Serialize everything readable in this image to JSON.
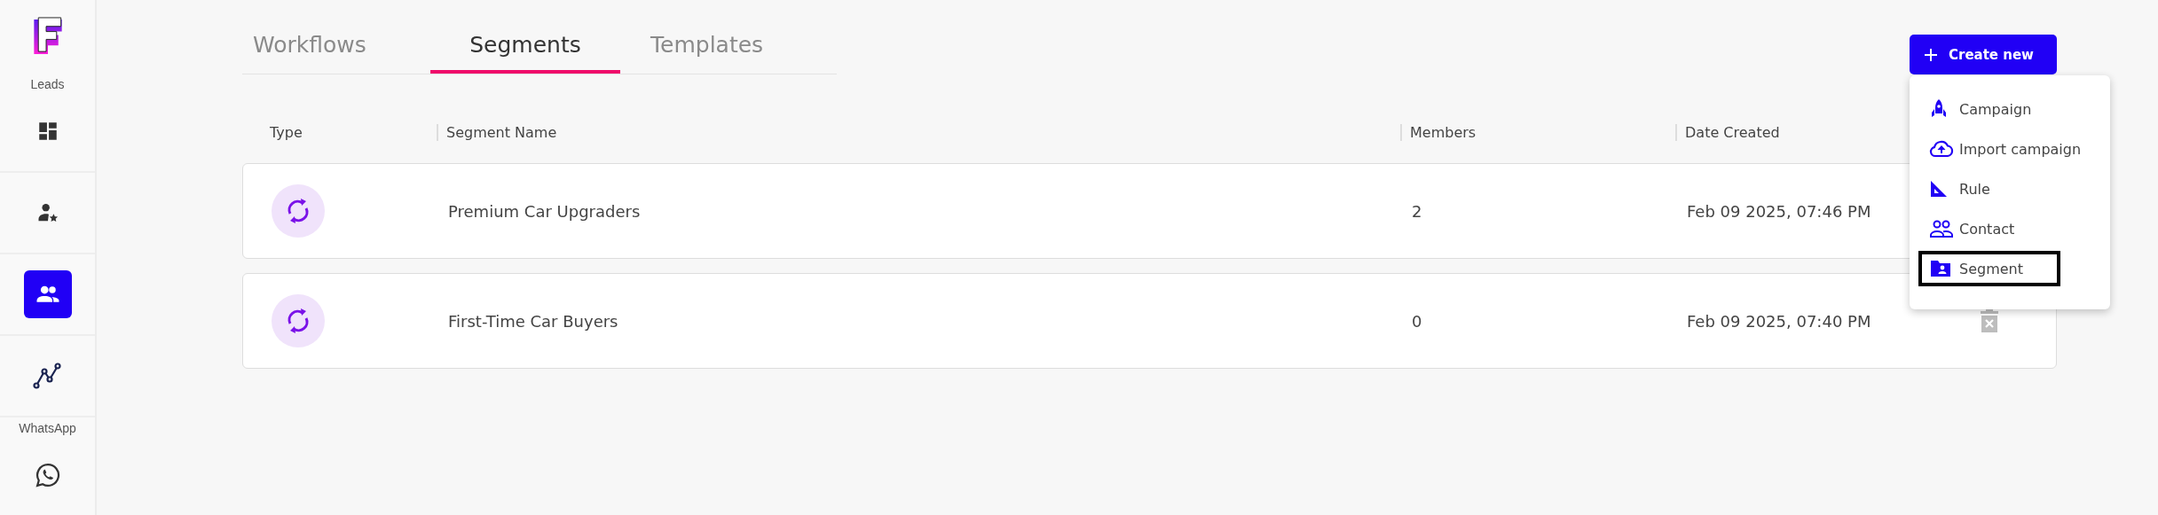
{
  "sidebar": {
    "labels": [
      "Leads",
      "WhatsApp"
    ],
    "items": [
      {
        "kind": "dashboard",
        "selected": false
      },
      {
        "kind": "person-star",
        "selected": false
      },
      {
        "kind": "group",
        "selected": true
      },
      {
        "kind": "chart",
        "selected": false
      },
      {
        "kind": "whatsapp",
        "selected": false
      }
    ]
  },
  "tabs": [
    {
      "label": "Workflows",
      "selected": false
    },
    {
      "label": "Segments",
      "selected": true
    },
    {
      "label": "Templates",
      "selected": false
    }
  ],
  "create_button": {
    "label": "Create new"
  },
  "create_menu": [
    {
      "kind": "rocket",
      "label": "Campaign",
      "selected": false
    },
    {
      "kind": "cloud",
      "label": "Import campaign",
      "selected": false
    },
    {
      "kind": "ruler",
      "label": "Rule",
      "selected": false
    },
    {
      "kind": "people",
      "label": "Contact",
      "selected": false
    },
    {
      "kind": "folder",
      "label": "Segment",
      "selected": true
    }
  ],
  "table": {
    "columns": [
      "Type",
      "Segment Name",
      "Members",
      "Date Created"
    ],
    "rows": [
      {
        "name": "Premium Car Upgraders",
        "members": "2",
        "date": "Feb 09 2025, 07:46 PM"
      },
      {
        "name": "First-Time Car Buyers",
        "members": "0",
        "date": "Feb 09 2025, 07:40 PM"
      }
    ]
  }
}
